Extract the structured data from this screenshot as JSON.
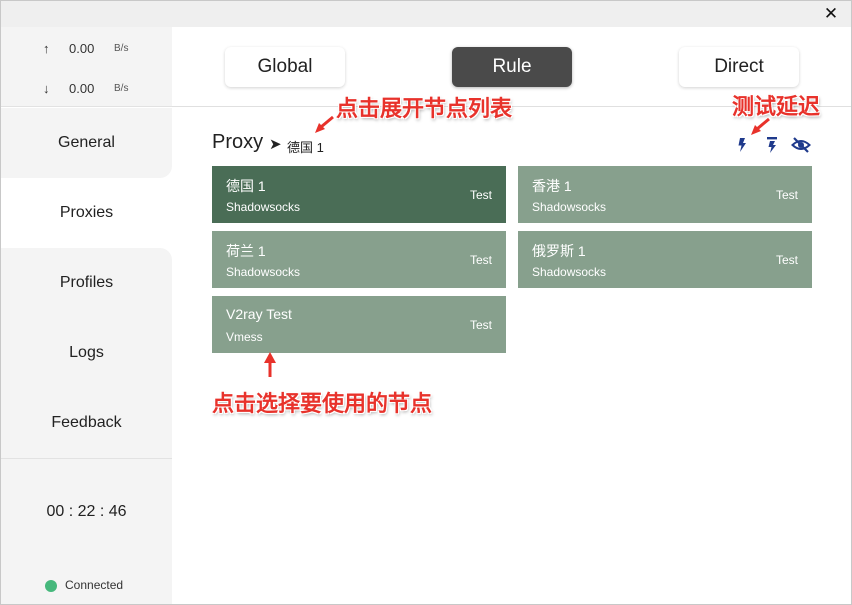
{
  "window": {
    "close_glyph": "✕"
  },
  "traffic": {
    "up_arrow": "↑",
    "up_value": "0.00",
    "up_unit": "B/s",
    "down_arrow": "↓",
    "down_value": "0.00",
    "down_unit": "B/s"
  },
  "nav": {
    "items": [
      {
        "label": "General"
      },
      {
        "label": "Proxies"
      },
      {
        "label": "Profiles"
      },
      {
        "label": "Logs"
      },
      {
        "label": "Feedback"
      }
    ],
    "active": "Proxies"
  },
  "status": {
    "timer": "00 : 22 : 46",
    "connection": "Connected",
    "connection_color": "#46b87c"
  },
  "modes": {
    "items": [
      {
        "label": "Global"
      },
      {
        "label": "Rule"
      },
      {
        "label": "Direct"
      }
    ],
    "active": "Rule"
  },
  "group": {
    "name": "Proxy",
    "arrow": "➤",
    "selected": "德国 1",
    "tools": [
      "speed-test-icon",
      "speed-test-sorted-icon",
      "hide-eye-icon"
    ]
  },
  "proxies": [
    {
      "name": "德国 1",
      "type": "Shadowsocks",
      "action": "Test",
      "selected": true
    },
    {
      "name": "香港 1",
      "type": "Shadowsocks",
      "action": "Test",
      "selected": false
    },
    {
      "name": "荷兰 1",
      "type": "Shadowsocks",
      "action": "Test",
      "selected": false
    },
    {
      "name": "俄罗斯 1",
      "type": "Shadowsocks",
      "action": "Test",
      "selected": false
    },
    {
      "name": "V2ray Test",
      "type": "Vmess",
      "action": "Test",
      "selected": false
    }
  ],
  "annotations": {
    "expand_list": "点击展开节点列表",
    "test_latency": "测试延迟",
    "select_node": "点击选择要使用的节点",
    "color": "#e8322b"
  },
  "colors": {
    "card_default": "#87a08d",
    "card_selected": "#4a6d56",
    "mode_active": "#4a4a4a",
    "icon_blue": "#1f3a8c"
  }
}
